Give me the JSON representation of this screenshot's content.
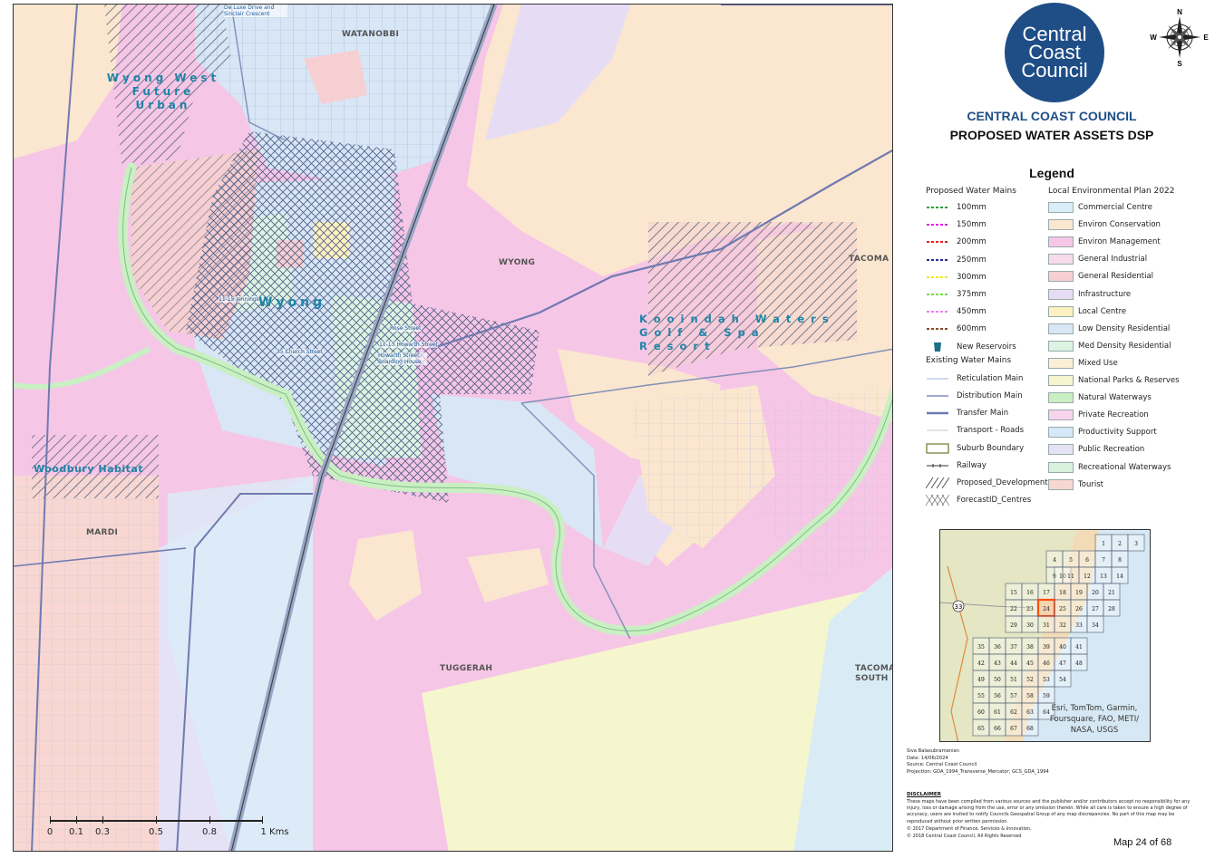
{
  "map": {
    "place_labels": [
      "WATANOBBI",
      "WYONG",
      "TACOMA",
      "MARDI",
      "TUGGERAH",
      "TACOMA SOUTH"
    ],
    "development_labels": [
      "Wyong West Future Urban",
      "Wyong",
      "Kooindah Waters Golf & Spa Resort",
      "Woodbury Habitat"
    ],
    "street_labels": [
      "De Luxe Drive and Sinclair Crescent",
      "11-15 Jennings",
      "35 Church Street",
      "Rose Street",
      "11-13 Howarth Street",
      "Howarth Street Boarding House"
    ],
    "scale": {
      "ticks": [
        "0",
        "0.1",
        "0.3",
        "0.5",
        "0.8"
      ],
      "end_label": "1 Kms"
    }
  },
  "colors": {
    "environ_management": "#f6c6e6",
    "environ_conservation": "#fbe6cf",
    "low_density": "#d8e6f6",
    "commercial": "#d9eef8",
    "general_residential": "#f6cfd2",
    "waterway": "#c9efc2",
    "public_recreation": "#e6ddf5",
    "local_centre": "#fcf1c0",
    "brand": "#1f4e87"
  },
  "logo": {
    "line1": "Central",
    "line2": "Coast",
    "line3": "Council"
  },
  "compass": {
    "n": "N",
    "e": "E",
    "s": "S",
    "w": "W"
  },
  "title": {
    "org": "CENTRAL COAST COUNCIL",
    "subtitle": "PROPOSED WATER ASSETS DSP"
  },
  "legend": {
    "title": "Legend",
    "proposed_heading": "Proposed Water Mains",
    "proposed": [
      {
        "label": "100mm",
        "color": "#2e9e3e",
        "icon": "dashed-line"
      },
      {
        "label": "150mm",
        "color": "#e020e0",
        "icon": "dashed-line"
      },
      {
        "label": "200mm",
        "color": "#e8201e",
        "icon": "dashed-line"
      },
      {
        "label": "250mm",
        "color": "#2d2f8e",
        "icon": "dashed-line"
      },
      {
        "label": "300mm",
        "color": "#f2e81a",
        "icon": "dashed-line"
      },
      {
        "label": "375mm",
        "color": "#6ee04a",
        "icon": "dashed-line"
      },
      {
        "label": "450mm",
        "color": "#f07af0",
        "icon": "dashed-line"
      },
      {
        "label": "600mm",
        "color": "#8a4a2a",
        "icon": "dashed-line"
      },
      {
        "label": "New Reservoirs",
        "color": "#1b6f8a",
        "icon": "reservoir"
      }
    ],
    "existing_heading": "Existing Water Mains",
    "existing": [
      {
        "label": "Reticulation Main",
        "color": "#9fb8dc",
        "icon": "thin-line"
      },
      {
        "label": "Distribution Main",
        "color": "#7f8fb8",
        "icon": "line"
      },
      {
        "label": "Transfer Main",
        "color": "#6f7ab0",
        "icon": "thick-line"
      },
      {
        "label": "Transport - Roads",
        "color": "#c8c8c8",
        "icon": "thin-line"
      },
      {
        "label": "Suburb Boundary",
        "color": "#6b7a2a",
        "icon": "box"
      },
      {
        "label": "Railway",
        "color": "#333333",
        "icon": "railway"
      },
      {
        "label": "Proposed_Developments",
        "color": "#555555",
        "icon": "hatch"
      },
      {
        "label": "ForecastID_Centres",
        "color": "#555555",
        "icon": "crosshatch"
      }
    ],
    "lep_heading": "Local Environmental Plan 2022",
    "lep": [
      {
        "label": "Commercial Centre",
        "color": "#d9eef8"
      },
      {
        "label": "Environ Conservation",
        "color": "#fbe6cf"
      },
      {
        "label": "Environ Management",
        "color": "#f6c6e6"
      },
      {
        "label": "General Industrial",
        "color": "#f8dcec"
      },
      {
        "label": "General Residential",
        "color": "#f6cfd2"
      },
      {
        "label": "Infrastructure",
        "color": "#e6ddf5"
      },
      {
        "label": "Local Centre",
        "color": "#fcf1c0"
      },
      {
        "label": "Low Density Residential",
        "color": "#d8e6f6"
      },
      {
        "label": "Med Density Residential",
        "color": "#ddf3e3"
      },
      {
        "label": "Mixed Use",
        "color": "#fcefd6"
      },
      {
        "label": "National Parks & Reserves",
        "color": "#f5f6cd"
      },
      {
        "label": "Natural Waterways",
        "color": "#c9efc2"
      },
      {
        "label": "Private Recreation",
        "color": "#f8d3ec"
      },
      {
        "label": "Productivity Support",
        "color": "#d6e9f8"
      },
      {
        "label": "Public Recreation",
        "color": "#e6e2f5"
      },
      {
        "label": "Recreational Waterways",
        "color": "#d8f1dc"
      },
      {
        "label": "Tourist",
        "color": "#f8d7d3"
      }
    ]
  },
  "inset": {
    "grid_numbers": [
      "1",
      "2",
      "3",
      "4",
      "5",
      "6",
      "7",
      "8",
      "9",
      "10",
      "11",
      "12",
      "13",
      "14",
      "15",
      "16",
      "17",
      "18",
      "19",
      "20",
      "21",
      "22",
      "23",
      "24",
      "25",
      "26",
      "27",
      "28",
      "29",
      "30",
      "31",
      "32",
      "33",
      "34",
      "35",
      "36",
      "37",
      "38",
      "39",
      "40",
      "41",
      "42",
      "43",
      "44",
      "45",
      "46",
      "47",
      "48",
      "49",
      "50",
      "51",
      "52",
      "53",
      "54",
      "55",
      "56",
      "57",
      "58",
      "59",
      "60",
      "61",
      "62",
      "63",
      "64",
      "65",
      "66",
      "67",
      "68"
    ],
    "current_map": "24",
    "road_label": "33",
    "credit": "Esri, TomTom, Garmin, Foursquare, FAO, METI/ NASA, USGS"
  },
  "meta": {
    "author": "Siva Balasubramanian",
    "date": "Date: 14/06/2024",
    "source": "Source: Central Coast Council",
    "projection": "Projection: GDA_1994_Transverse_Mercator; GCS_GDA_1994"
  },
  "disclaimer": {
    "heading": "DISCLAIMER",
    "text": "These maps have been compiled from various sources and the publisher and/or contributors accept no responsibility for any injury, loss or damage arising from the use, error or any omission therein. While all care is taken to ensure a high degree of accuracy, users are invited to notify Councils Geospatial Group of any map discrepancies. No part of this map may be reproduced without prior written permission.",
    "copyright1": "© 2017 Department of Finance, Services & Innovation,",
    "copyright2": "© 2018 Central Coast Council, All Rights Reserved"
  },
  "page": {
    "label": "Map 24 of 68"
  }
}
